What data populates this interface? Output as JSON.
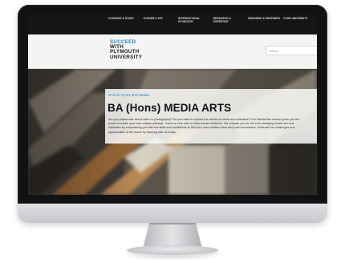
{
  "nav": {
    "items": [
      {
        "label": "COURSES & STUDY"
      },
      {
        "label": "STUDENT LIFE"
      },
      {
        "label": "INTERNATIONAL PLYMOUTH"
      },
      {
        "label": "RESEARCH & EXPERTISE"
      },
      {
        "label": "BUSINESS & PARTNERS"
      },
      {
        "label": "YOUR UNIVERSITY"
      }
    ]
  },
  "header": {
    "logo_lines": [
      "SUCCEED",
      "WITH",
      "PLYMOUTH",
      "UNIVERSITY"
    ],
    "search_placeholder": "Search"
  },
  "hero": {
    "department": "School of Art and Media",
    "title": "BA (Hons) MEDIA ARTS",
    "intro": "Are you passionate about video or photography? Do you want to explore the worlds of sound and animation? Our Media Arts course gives you the power to create your own unique pathway - focus on one area or work across mediums. We prepare you for the ever-changing media and arts industries by empowering you with the skills and confidence to find your own creative voice and push boundaries. Embrace the challenges and opportunities of the future by learning with us today."
  },
  "colors": {
    "accent": "#1a87c9",
    "nav_background": "#141517"
  },
  "icons": {
    "brand": "apple-logo"
  }
}
